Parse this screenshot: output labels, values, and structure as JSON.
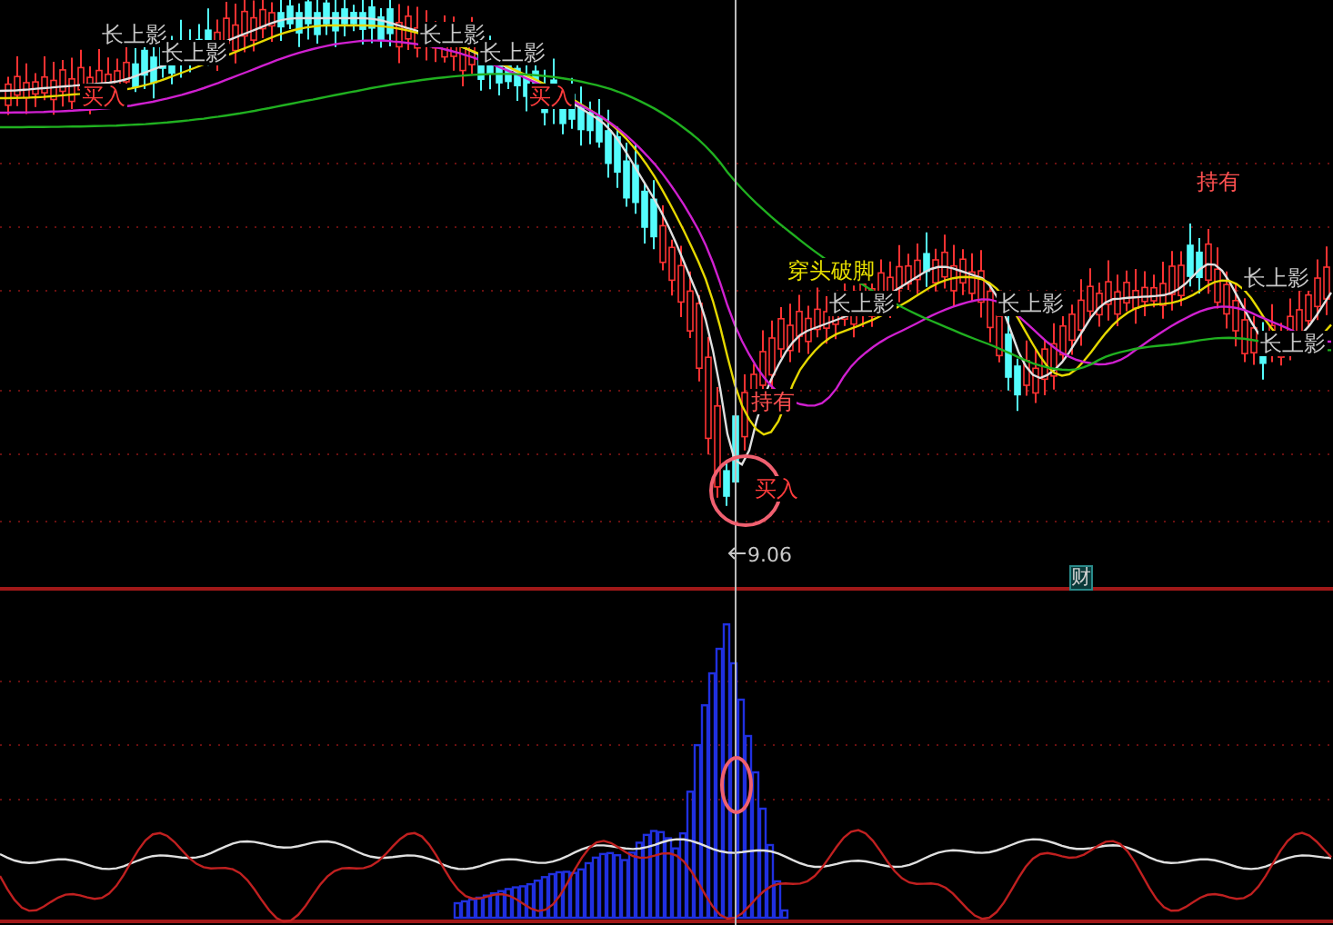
{
  "price_panel": {
    "annotations": [
      {
        "kind": "signal",
        "text": "长上影"
      },
      {
        "kind": "signal",
        "text": "长上影"
      },
      {
        "kind": "buy",
        "text": "买入"
      },
      {
        "kind": "signal",
        "text": "长上影"
      },
      {
        "kind": "signal",
        "text": "长上影"
      },
      {
        "kind": "buy",
        "text": "买入"
      },
      {
        "kind": "pattern",
        "text": "穿头破脚"
      },
      {
        "kind": "signal",
        "text": "长上影"
      },
      {
        "kind": "hold",
        "text": "持有"
      },
      {
        "kind": "buy",
        "text": "买入"
      },
      {
        "kind": "signal",
        "text": "长上影"
      },
      {
        "kind": "hold",
        "text": "持有"
      },
      {
        "kind": "signal",
        "text": "长上影"
      },
      {
        "kind": "signal",
        "text": "长上影"
      }
    ],
    "low_price_label": "9.06",
    "finance_marker": "财"
  }
}
